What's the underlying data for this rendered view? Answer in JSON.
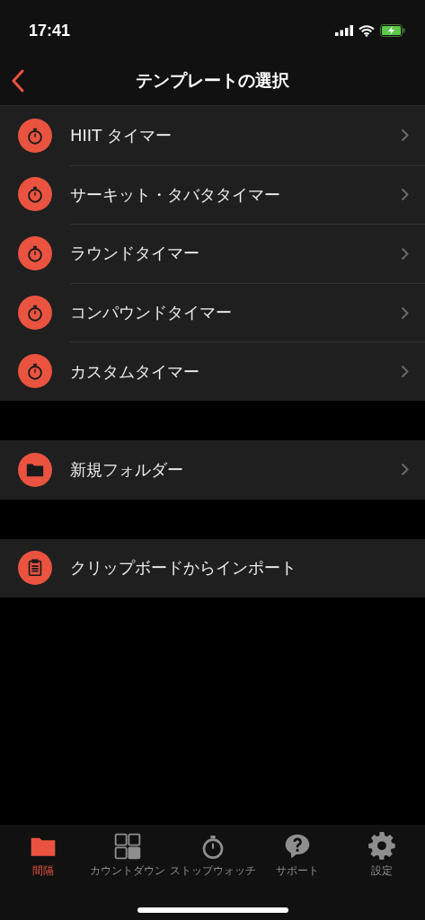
{
  "status_bar": {
    "time": "17:41"
  },
  "nav": {
    "title": "テンプレートの選択"
  },
  "sections": [
    {
      "items": [
        {
          "label": "HIIT タイマー",
          "kind": "stopwatch",
          "chevron": true
        },
        {
          "label": "サーキット・タバタタイマー",
          "kind": "stopwatch",
          "chevron": true
        },
        {
          "label": "ラウンドタイマー",
          "kind": "stopwatch",
          "chevron": true
        },
        {
          "label": "コンパウンドタイマー",
          "kind": "stopwatch",
          "chevron": true
        },
        {
          "label": "カスタムタイマー",
          "kind": "stopwatch",
          "chevron": true
        }
      ]
    },
    {
      "items": [
        {
          "label": "新規フォルダー",
          "kind": "folder",
          "chevron": true
        }
      ]
    },
    {
      "items": [
        {
          "label": "クリップボードからインポート",
          "kind": "clipboard",
          "chevron": false
        }
      ]
    }
  ],
  "tab_bar": [
    {
      "label": "間隔",
      "kind": "folder",
      "selected": true
    },
    {
      "label": "カウントダウン",
      "kind": "grid",
      "selected": false
    },
    {
      "label": "ストップウォッチ",
      "kind": "stopwatch",
      "selected": false
    },
    {
      "label": "サポート",
      "kind": "help",
      "selected": false
    },
    {
      "label": "設定",
      "kind": "gear",
      "selected": false
    }
  ]
}
